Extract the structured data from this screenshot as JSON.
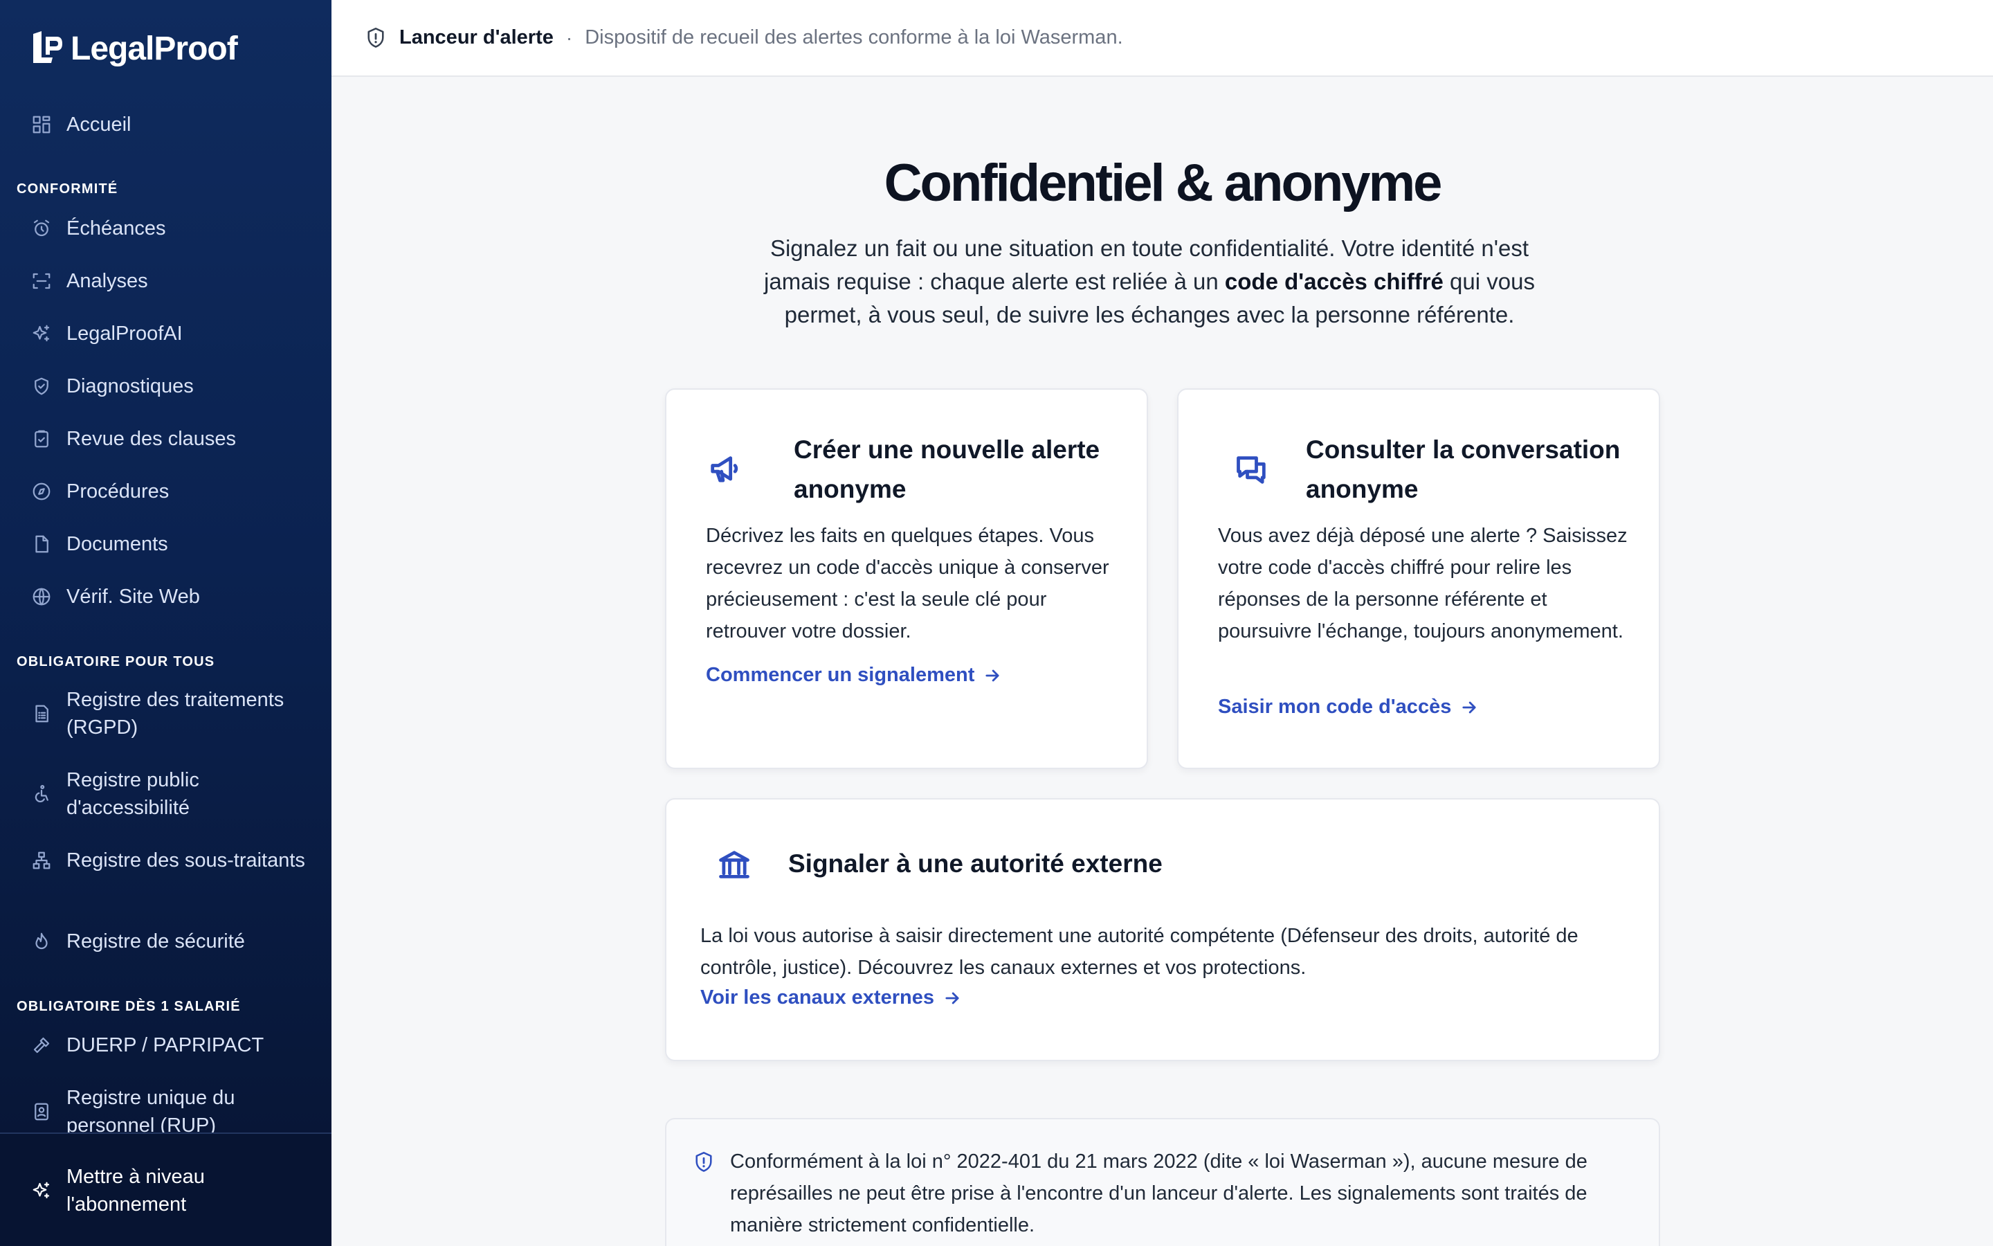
{
  "brand": {
    "name": "LegalProof"
  },
  "sidebar": {
    "home": {
      "label": "Accueil",
      "icon": "dashboard-icon"
    },
    "sections": [
      {
        "title": "CONFORMITÉ",
        "items": [
          {
            "label": "Échéances",
            "icon": "alarm-clock-icon"
          },
          {
            "label": "Analyses",
            "icon": "scan-icon"
          },
          {
            "label": "LegalProofAI",
            "icon": "sparkles-icon"
          },
          {
            "label": "Diagnostiques",
            "icon": "shield-check-icon"
          },
          {
            "label": "Revue des clauses",
            "icon": "clipboard-check-icon"
          },
          {
            "label": "Procédures",
            "icon": "compass-icon"
          },
          {
            "label": "Documents",
            "icon": "document-icon"
          },
          {
            "label": "Vérif. Site Web",
            "icon": "globe-icon"
          }
        ]
      },
      {
        "title": "OBLIGATOIRE POUR TOUS",
        "items": [
          {
            "label": "Registre des traitements (RGPD)",
            "icon": "file-list-icon"
          },
          {
            "label": "Registre public d'accessibilité",
            "icon": "accessibility-icon"
          },
          {
            "label": "Registre des sous-traitants",
            "icon": "hierarchy-icon"
          },
          {
            "label": "Registre de sécurité",
            "icon": "flame-icon"
          }
        ]
      },
      {
        "title": "OBLIGATOIRE DÈS 1 SALARIÉ",
        "items": [
          {
            "label": "DUERP / PAPRIPACT",
            "icon": "hammer-icon"
          },
          {
            "label": "Registre unique du personnel (RUP)",
            "icon": "id-badge-icon"
          }
        ]
      }
    ],
    "footer": {
      "label": "Mettre à niveau l'abonnement",
      "icon": "sparkles-icon"
    }
  },
  "header": {
    "title": "Lanceur d'alerte",
    "separator": "·",
    "subtitle": "Dispositif de recueil des alertes conforme à la loi Waserman."
  },
  "hero": {
    "title": "Confidentiel & anonyme",
    "text_before": "Signalez un fait ou une situation en toute confidentialité. Votre identité n'est jamais requise : chaque alerte est reliée à un ",
    "text_bold": "code d'accès chiffré",
    "text_after": " qui vous permet, à vous seul, de suivre les échanges avec la personne référente."
  },
  "cards": {
    "new_alert": {
      "icon": "megaphone-icon",
      "title": "Créer une nouvelle alerte anonyme",
      "text": "Décrivez les faits en quelques étapes. Vous recevrez un code d'accès unique à conserver précieusement : c'est la seule clé pour retrouver votre dossier.",
      "link": "Commencer un signalement"
    },
    "conversation": {
      "icon": "chat-bubbles-icon",
      "title": "Consulter la conversation anonyme",
      "text": "Vous avez déjà déposé une alerte ? Saisissez votre code d'accès chiffré pour relire les réponses de la personne référente et poursuivre l'échange, toujours anonymement.",
      "link": "Saisir mon code d'accès"
    },
    "external": {
      "icon": "institution-icon",
      "title": "Signaler à une autorité externe",
      "text": "La loi vous autorise à saisir directement une autorité compétente (Défenseur des droits, autorité de contrôle, justice). Découvrez les canaux externes et vos protections.",
      "link": "Voir les canaux externes"
    }
  },
  "notice": {
    "text": "Conformément à la loi n° 2022-401 du 21 mars 2022 (dite « loi Waserman »), aucune mesure de représailles ne peut être prise à l'encontre d'un lanceur d'alerte. Les signalements sont traités de manière strictement confidentielle."
  },
  "colors": {
    "accent": "#2f4fc0",
    "sidebar": "#0b2250",
    "background": "#f6f7f9"
  }
}
